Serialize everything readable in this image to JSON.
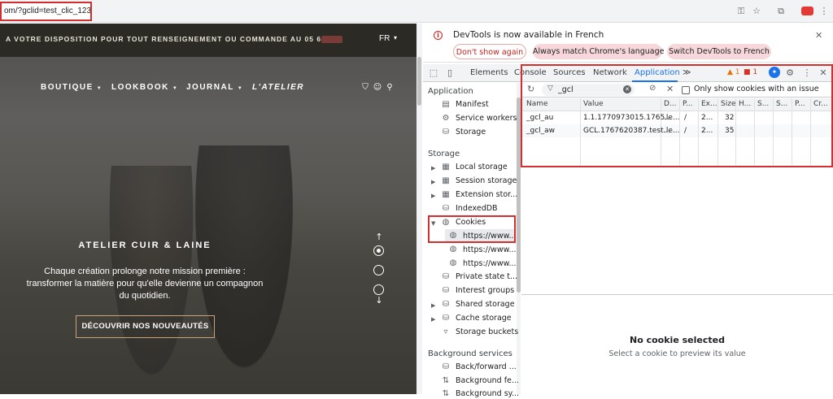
{
  "browser": {
    "url": "om/?gclid=test_clic_123",
    "icons": [
      "key-icon",
      "star-icon",
      "extension-icon",
      "profile-icon",
      "menu-icon"
    ]
  },
  "site": {
    "promo": "A VOTRE DISPOSITION POUR TOUT RENSEIGNEMENT OU COMMANDE AU 05 65 99",
    "lang": "FR",
    "nav": [
      "BOUTIQUE",
      "LOOKBOOK",
      "JOURNAL",
      "L'ATELIER"
    ],
    "hero_title": "ATELIER CUIR & LAINE",
    "hero_lines": [
      "Chaque création prolonge notre mission première :",
      "transformer la matière pour qu'elle devienne un compagnon",
      "du quotidien."
    ],
    "cta": "DÉCOUVRIR NOS NOUVEAUTÉS"
  },
  "devtools": {
    "banner": {
      "message": "DevTools is now available in French",
      "dont_show": "Don't show again",
      "match": "Always match Chrome's language",
      "switch": "Switch DevTools to French"
    },
    "tabs": [
      "Elements",
      "Console",
      "Sources",
      "Network",
      "Application"
    ],
    "more_tabs": "≫",
    "warnings": "1",
    "errors": "1",
    "sidebar": {
      "application_header": "Application",
      "application_items": [
        "Manifest",
        "Service workers",
        "Storage"
      ],
      "storage_header": "Storage",
      "storage_items": [
        "Local storage",
        "Session storage",
        "Extension stor...",
        "IndexedDB",
        "Cookies"
      ],
      "cookie_origins": [
        "https://www...",
        "https://www...",
        "https://www..."
      ],
      "more_items": [
        "Private state t...",
        "Interest groups",
        "Shared storage",
        "Cache storage",
        "Storage buckets"
      ],
      "background_header": "Background services",
      "background_items": [
        "Back/forward ...",
        "Background fe...",
        "Background sy..."
      ]
    },
    "filter": {
      "value": "_gcl",
      "only_issues": "Only show cookies with an issue"
    },
    "table": {
      "columns": [
        "Name",
        "Value",
        "D...",
        "P...",
        "Ex...",
        "Size",
        "H...",
        "S...",
        "S...",
        "P...",
        "Cr..."
      ],
      "rows": [
        [
          "_gcl_au",
          "1.1.1770973015.1765...",
          ".le...",
          "/",
          "2...",
          "32"
        ],
        [
          "_gcl_aw",
          "GCL.1767620387.test...",
          ".le...",
          "/",
          "2...",
          "35"
        ]
      ]
    },
    "preview": {
      "title": "No cookie selected",
      "subtitle": "Select a cookie to preview its value"
    }
  }
}
